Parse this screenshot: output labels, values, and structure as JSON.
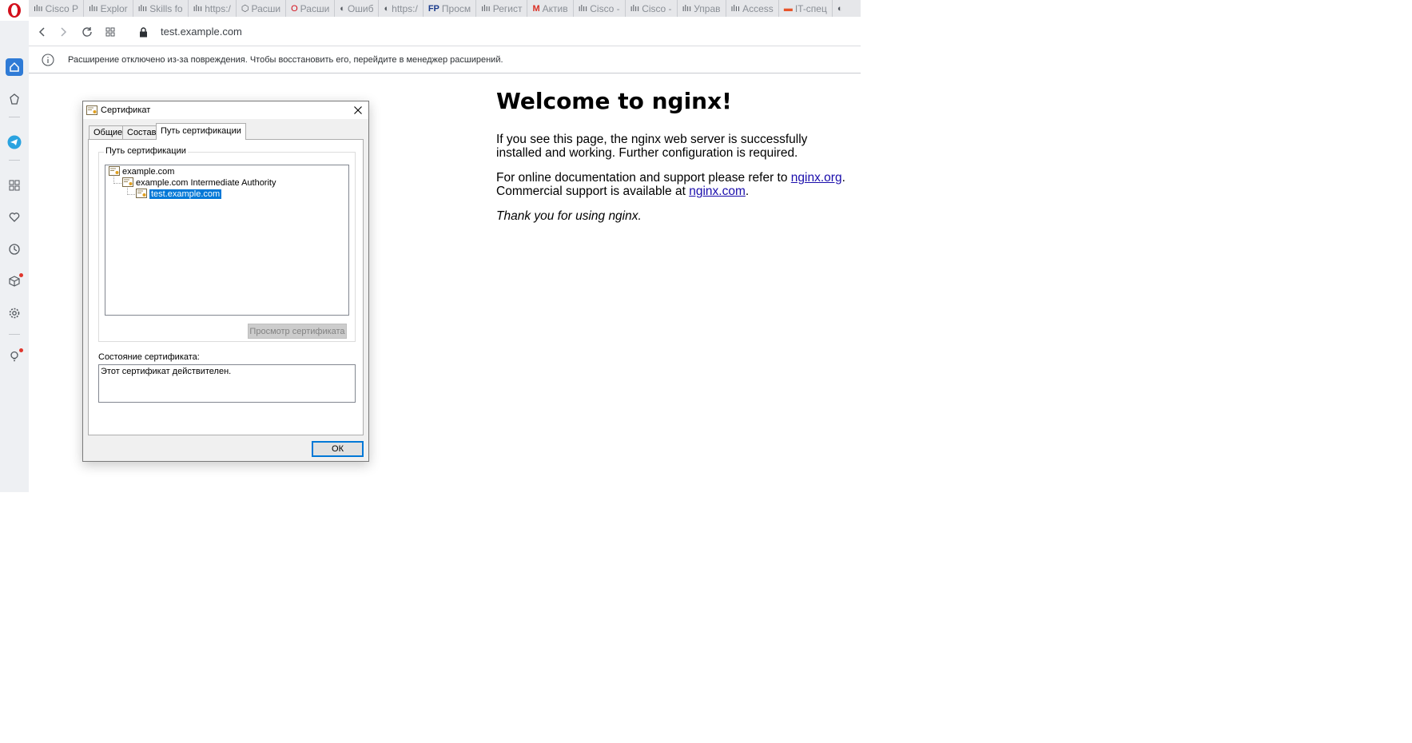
{
  "browser": {
    "tabs": [
      {
        "label": "Cisco P",
        "icon": "cisco-icon"
      },
      {
        "label": "Explor",
        "icon": "cisco-icon"
      },
      {
        "label": "Skills fo",
        "icon": "cisco-icon"
      },
      {
        "label": "https:/",
        "icon": "cisco-icon"
      },
      {
        "label": "Расши",
        "icon": "extension-cube-icon"
      },
      {
        "label": "Расши",
        "icon": "opera-icon"
      },
      {
        "label": "Ошиб",
        "icon": "globe-icon"
      },
      {
        "label": "https:/",
        "icon": "globe-icon"
      },
      {
        "label": "Просм",
        "icon": "fp-icon"
      },
      {
        "label": "Регист",
        "icon": "cisco-icon"
      },
      {
        "label": "Актив",
        "icon": "gmail-icon"
      },
      {
        "label": "Cisco -",
        "icon": "cisco-icon"
      },
      {
        "label": "Cisco -",
        "icon": "cisco-icon"
      },
      {
        "label": "Управ",
        "icon": "cisco-icon"
      },
      {
        "label": "Access",
        "icon": "cisco-icon"
      },
      {
        "label": "IT-спец",
        "icon": "it-icon"
      },
      {
        "label": "",
        "icon": "globe-icon"
      }
    ],
    "address": {
      "url": "test.example.com"
    },
    "infobar": {
      "text": "Расширение отключено из-за повреждения. Чтобы восстановить его, перейдите в менеджер расширений."
    },
    "accent_color": "#2f7bd6"
  },
  "page": {
    "title": "Welcome to nginx!",
    "p1": "If you see this page, the nginx web server is successfully installed and working. Further configuration is required.",
    "p2_prefix": "For online documentation and support please refer to ",
    "p2_link1": "nginx.org",
    "p2_mid": ".",
    "p2_line2": "Commercial support is available at ",
    "p2_link2": "nginx.com",
    "p2_suffix": ".",
    "p3": "Thank you for using nginx."
  },
  "dialog": {
    "title": "Сертификат",
    "tabs": [
      "Общие",
      "Состав",
      "Путь сертификации"
    ],
    "active_tab": "Путь сертификации",
    "path_group_label": "Путь сертификации",
    "tree": [
      "example.com",
      "example.com Intermediate Authority",
      "test.example.com"
    ],
    "view_button": "Просмотр сертификата",
    "status_label": "Состояние сертификата:",
    "status_text": "Этот сертификат действителен.",
    "ok_button": "ОК",
    "selection_color": "#0078d7"
  }
}
